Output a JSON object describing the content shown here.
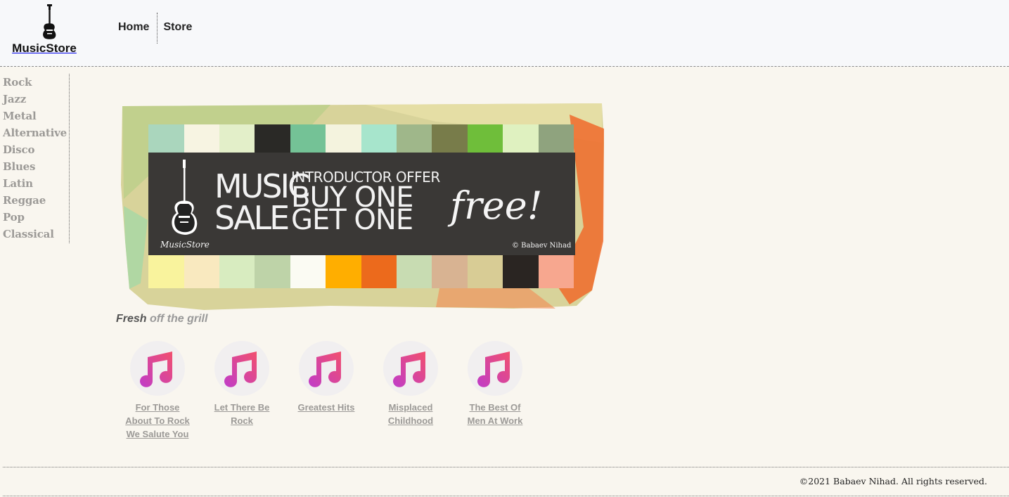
{
  "header": {
    "logo_text": "MusicStore",
    "nav": [
      {
        "label": "Home"
      },
      {
        "label": "Store"
      }
    ]
  },
  "sidebar": {
    "genres": [
      "Rock",
      "Jazz",
      "Metal",
      "Alternative",
      "Disco",
      "Blues",
      "Latin",
      "Reggae",
      "Pop",
      "Classical"
    ]
  },
  "banner": {
    "line_music": "MUSIC",
    "line_sale": "SALE",
    "introductory": "INTRODUCTOR OFFER",
    "buy_one": "BUY ONE",
    "get_one": "GET ONE",
    "free": "free!",
    "brand": "MusicStore",
    "copyright": "© Babaev Nihad"
  },
  "fresh": {
    "lead": "Fresh",
    "rest": "off the grill"
  },
  "albums": [
    {
      "title": "For Those About To Rock We Salute You",
      "icon": "music-note-icon"
    },
    {
      "title": "Let There Be Rock",
      "icon": "music-note-icon"
    },
    {
      "title": "Greatest Hits",
      "icon": "music-note-icon"
    },
    {
      "title": "Misplaced Childhood",
      "icon": "music-note-icon"
    },
    {
      "title": "The Best Of Men At Work",
      "icon": "music-note-icon"
    }
  ],
  "footer": {
    "text": "©2021 Babaev Nihad. All rights reserved."
  },
  "colors": {
    "background": "#f9f6ef",
    "header_bg": "#f7f8fa",
    "link_muted": "#9c9a97",
    "banner_dark": "#3a3836",
    "note_gradient_start": "#c03cc9",
    "note_gradient_end": "#f2506e"
  }
}
